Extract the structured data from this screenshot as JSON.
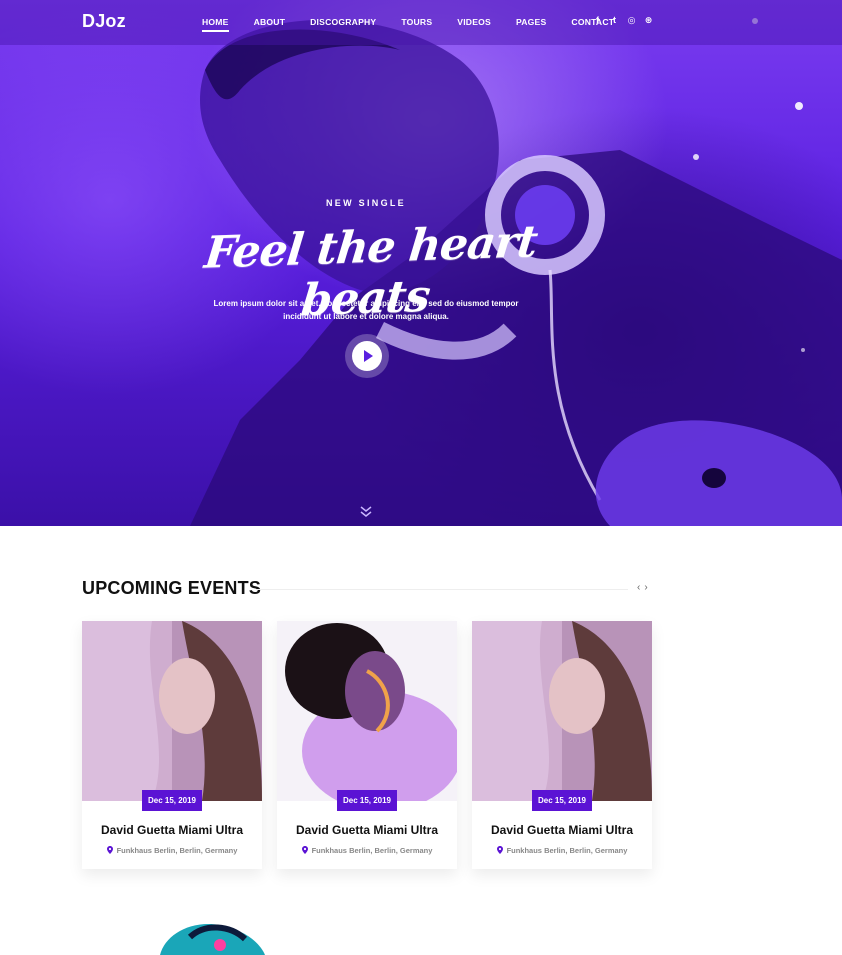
{
  "brand": {
    "logo": "DJoz"
  },
  "nav": {
    "items": [
      {
        "label": "HOME",
        "active": true
      },
      {
        "label": "ABOUT",
        "active": false
      },
      {
        "label": "DISCOGRAPHY",
        "active": false
      },
      {
        "label": "TOURS",
        "active": false
      },
      {
        "label": "VIDEOS",
        "active": false
      },
      {
        "label": "PAGES",
        "active": false
      },
      {
        "label": "CONTACT",
        "active": false
      }
    ],
    "social": [
      {
        "icon": "facebook-icon",
        "glyph": "f"
      },
      {
        "icon": "twitter-icon",
        "glyph": "t"
      },
      {
        "icon": "instagram-icon",
        "glyph": "◎"
      },
      {
        "icon": "dribbble-icon",
        "glyph": "⊛"
      }
    ]
  },
  "hero": {
    "kicker": "NEW SINGLE",
    "headline": "Feel the heart beats",
    "lead": "Lorem ipsum dolor sit amet, consectetur adipiscing elit, sed do eiusmod tempor incididunt ut labore et dolore magna aliqua.",
    "play_icon": "play-icon",
    "scroll_icon": "double-chevron-down-icon"
  },
  "events": {
    "title": "UPCOMING EVENTS",
    "prev": "‹",
    "next": "›",
    "cards": [
      {
        "date": "Dec 15, 2019",
        "title": "David Guetta Miami Ultra",
        "location": "Funkhaus Berlin, Berlin, Germany"
      },
      {
        "date": "Dec 15, 2019",
        "title": "David Guetta Miami Ultra",
        "location": "Funkhaus Berlin, Berlin, Germany"
      },
      {
        "date": "Dec 15, 2019",
        "title": "David Guetta Miami Ultra",
        "location": "Funkhaus Berlin, Berlin, Germany"
      }
    ]
  },
  "colors": {
    "accent": "#5b13d4",
    "hero_purple": "#5a1fe0",
    "title_text": "#111111",
    "muted_text": "#888888"
  }
}
